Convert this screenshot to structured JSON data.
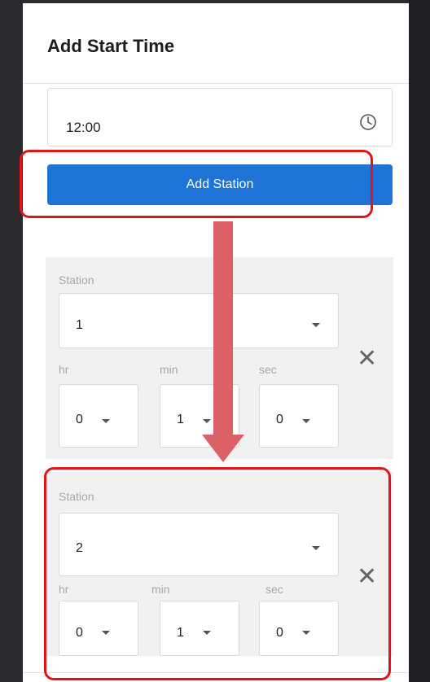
{
  "modal": {
    "title": "Add Start Time"
  },
  "time_field": {
    "value": "12:00",
    "icon": "clock-icon"
  },
  "add_station_button": {
    "label": "Add Station"
  },
  "labels": {
    "station": "Station",
    "hr": "hr",
    "min": "min",
    "sec": "sec"
  },
  "stations": [
    {
      "station": "1",
      "hr": "0",
      "min": "1",
      "sec": "0",
      "remove_icon": "close-icon"
    },
    {
      "station": "2",
      "hr": "0",
      "min": "1",
      "sec": "0",
      "remove_icon": "close-icon"
    }
  ],
  "colors": {
    "primary_button": "#1e73d6",
    "highlight": "#e0141b",
    "arrow": "#dc6166",
    "card_background": "#f1f1f1"
  }
}
